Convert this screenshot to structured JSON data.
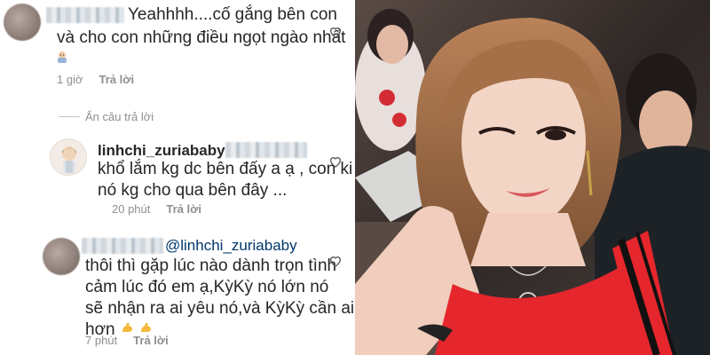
{
  "comments": [
    {
      "text_line1": "Yeahhhh....cố gắng bên con",
      "text_line2": "và cho con những điều ngọt ngào nhất",
      "time": "1 giờ",
      "reply_label": "Trả lời"
    },
    {
      "username": "linhchi_zuriababy",
      "text_line1": "khổ lắm kg dc bên đấy a ạ , con kia",
      "text_line2": "nó kg cho qua bên đây ...",
      "time": "20 phút",
      "reply_label": "Trả lời"
    },
    {
      "mention": "@linhchi_zuriababy",
      "text_line1": "thôi thì gặp lúc nào dành trọn tình",
      "text_line2": "cảm lúc đó em ạ,KỳKỳ nó lớn nó",
      "text_line3": "sẽ nhận ra ai yêu nó,và KỳKỳ cần ai",
      "text_line4": "hơn",
      "time": "7 phút",
      "reply_label": "Trả lời"
    }
  ],
  "hide_replies_label": "Ẩn câu trả lời",
  "icons": [
    "heart-icon",
    "baby-emoji",
    "flexed-biceps-emoji"
  ],
  "colors": {
    "text": "#262626",
    "meta": "#8e8e8e",
    "mention": "#00376b",
    "dress": "#e8242a"
  }
}
